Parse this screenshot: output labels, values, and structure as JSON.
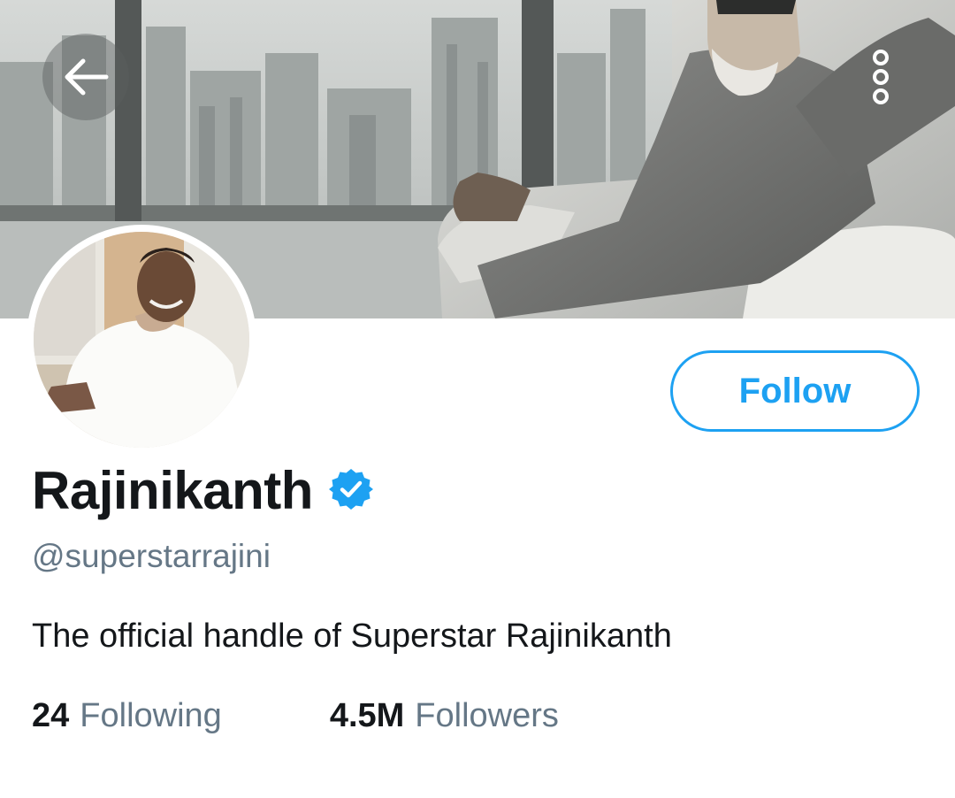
{
  "profile": {
    "display_name": "Rajinikanth",
    "handle": "@superstarrajini",
    "bio": "The official handle of Superstar Rajinikanth",
    "verified": true
  },
  "actions": {
    "follow_label": "Follow"
  },
  "stats": {
    "following_count": "24",
    "following_label": "Following",
    "followers_count": "4.5M",
    "followers_label": "Followers"
  },
  "icons": {
    "back": "back-arrow-icon",
    "more": "more-options-icon",
    "verified": "verified-badge-icon"
  },
  "colors": {
    "accent": "#1da1f2",
    "text_primary": "#14171a",
    "text_secondary": "#657786"
  }
}
